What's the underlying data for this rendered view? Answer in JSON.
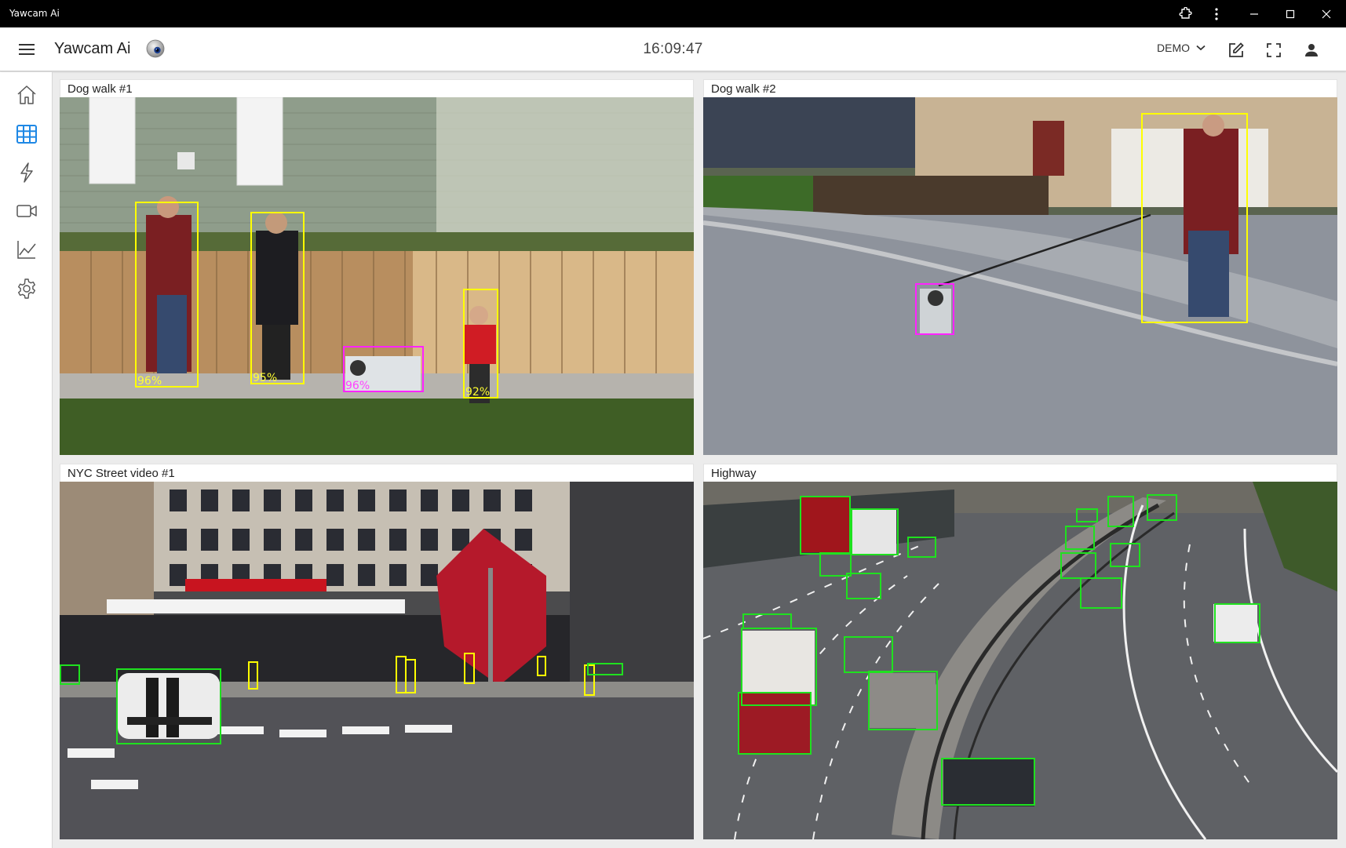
{
  "window": {
    "title": "Yawcam Ai"
  },
  "header": {
    "app_title": "Yawcam Ai",
    "clock": "16:09:47",
    "profile": "DEMO"
  },
  "icons": {
    "menu": "hamburger-icon",
    "logo": "webcam-lens-icon",
    "edit": "edit-icon",
    "fullscreen": "fullscreen-icon",
    "user": "person-icon",
    "extension": "extension-icon",
    "more": "more-vertical-icon"
  },
  "sidebar": {
    "items": [
      {
        "name": "home",
        "icon": "home-icon"
      },
      {
        "name": "grid",
        "icon": "grid-icon",
        "active": true
      },
      {
        "name": "events",
        "icon": "lightning-icon"
      },
      {
        "name": "cameras",
        "icon": "video-camera-icon"
      },
      {
        "name": "statistics",
        "icon": "line-chart-icon"
      },
      {
        "name": "settings",
        "icon": "gear-icon"
      }
    ]
  },
  "colors": {
    "accent": "#1e88e5",
    "person_box": "#ffff00",
    "dog_box": "#ff22ff",
    "vehicle_box": "#1fe11f"
  },
  "cameras": [
    {
      "title": "Dog walk #1",
      "detections": [
        {
          "label": "96%"
        },
        {
          "label": "95%"
        },
        {
          "label": "96%"
        },
        {
          "label": "92%"
        }
      ]
    },
    {
      "title": "Dog walk #2"
    },
    {
      "title": "NYC Street video #1"
    },
    {
      "title": "Highway"
    }
  ]
}
